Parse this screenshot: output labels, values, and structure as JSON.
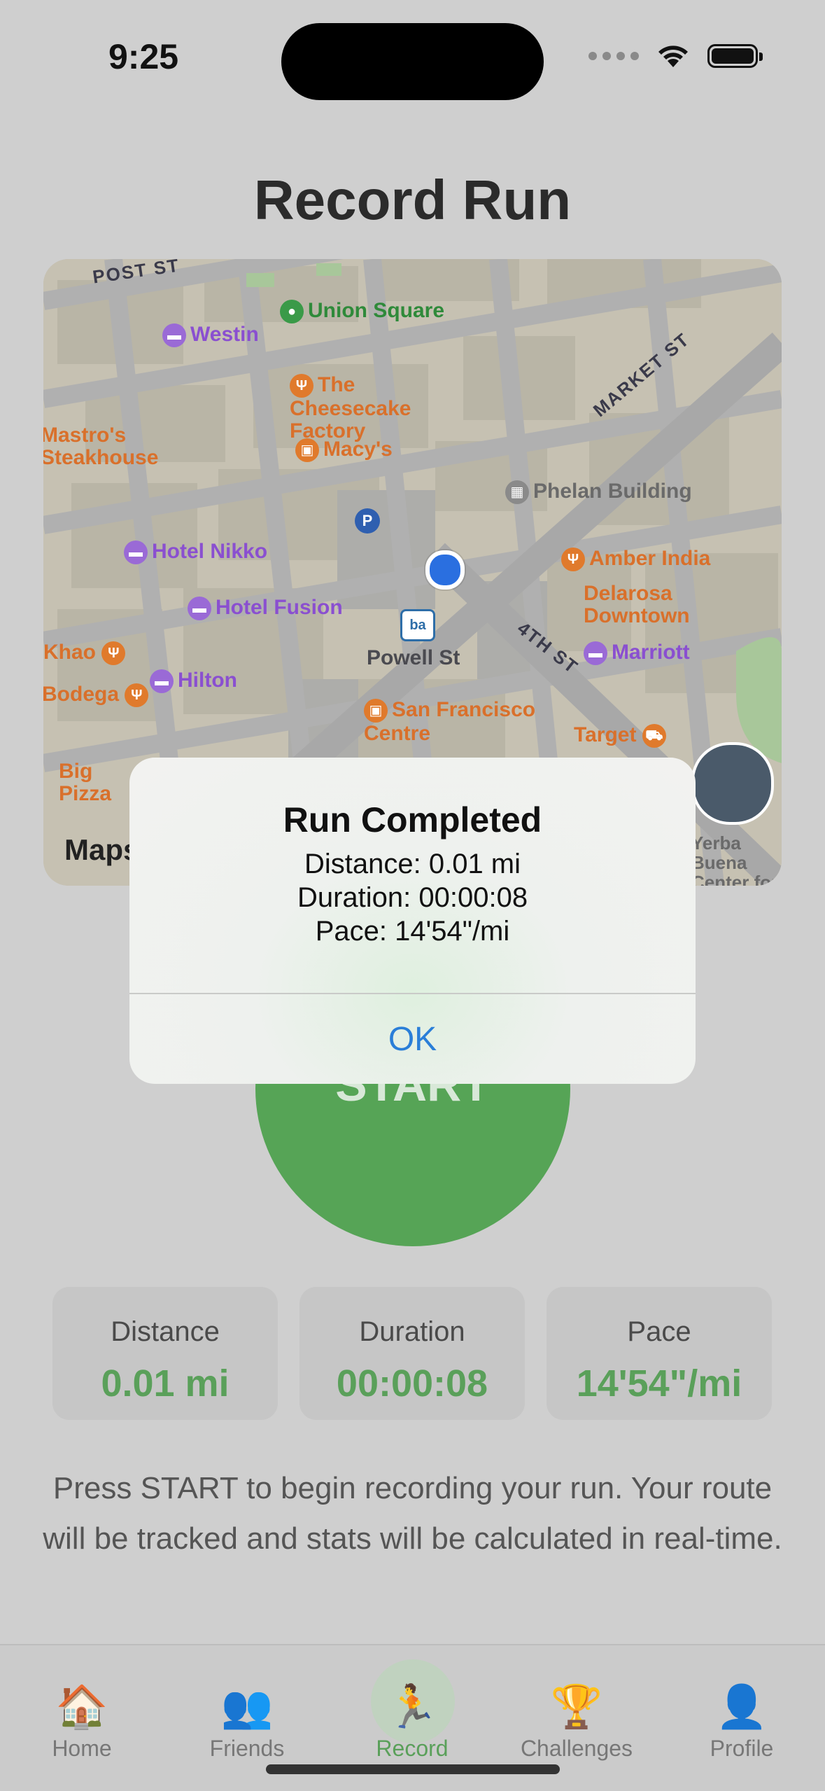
{
  "status_bar": {
    "time": "9:25"
  },
  "page": {
    "title": "Record Run"
  },
  "map": {
    "streets": [
      "POST ST",
      "MARKET ST",
      "4TH ST"
    ],
    "pois": [
      {
        "name": "Union Square",
        "color": "green"
      },
      {
        "name": "Westin",
        "color": "purple"
      },
      {
        "name": "The Cheesecake Factory",
        "color": "orange"
      },
      {
        "name": "Mastro's Steakhouse",
        "color": "orange"
      },
      {
        "name": "Macy's",
        "color": "orange"
      },
      {
        "name": "Phelan Building",
        "color": "gray"
      },
      {
        "name": "Hotel Nikko",
        "color": "purple"
      },
      {
        "name": "Amber India",
        "color": "orange"
      },
      {
        "name": "Hotel Fusion",
        "color": "purple"
      },
      {
        "name": "Delarosa Downtown",
        "color": "orange"
      },
      {
        "name": "Khao",
        "color": "orange"
      },
      {
        "name": "Marriott",
        "color": "purple"
      },
      {
        "name": "Bodega",
        "color": "orange"
      },
      {
        "name": "Hilton",
        "color": "purple"
      },
      {
        "name": "San Francisco Centre",
        "color": "orange"
      },
      {
        "name": "Target",
        "color": "orange"
      },
      {
        "name": "Big Pizza",
        "color": "orange"
      },
      {
        "name": "Yerba Buena Center for the Arts",
        "color": "gray"
      }
    ],
    "station": {
      "label": "Powell St",
      "badge": "ba"
    },
    "parking_badge": "P",
    "attribution": "Maps"
  },
  "start_button": {
    "label": "START"
  },
  "stats": [
    {
      "label": "Distance",
      "value": "0.01 mi"
    },
    {
      "label": "Duration",
      "value": "00:00:08"
    },
    {
      "label": "Pace",
      "value": "14'54\"/mi"
    }
  ],
  "hint": "Press START to begin recording your run. Your route will be tracked and stats will be calculated in real-time.",
  "tabs": [
    {
      "label": "Home",
      "icon": "🏠",
      "active": false
    },
    {
      "label": "Friends",
      "icon": "👥",
      "active": false
    },
    {
      "label": "Record",
      "icon": "🏃",
      "active": true
    },
    {
      "label": "Challenges",
      "icon": "🏆",
      "active": false
    },
    {
      "label": "Profile",
      "icon": "👤",
      "active": false
    }
  ],
  "alert": {
    "title": "Run Completed",
    "distance": "Distance: 0.01 mi",
    "duration": "Duration: 00:00:08",
    "pace": "Pace: 14'54\"/mi",
    "ok_label": "OK"
  },
  "colors": {
    "accent_green": "#56a456",
    "link_blue": "#2a7ed8"
  }
}
